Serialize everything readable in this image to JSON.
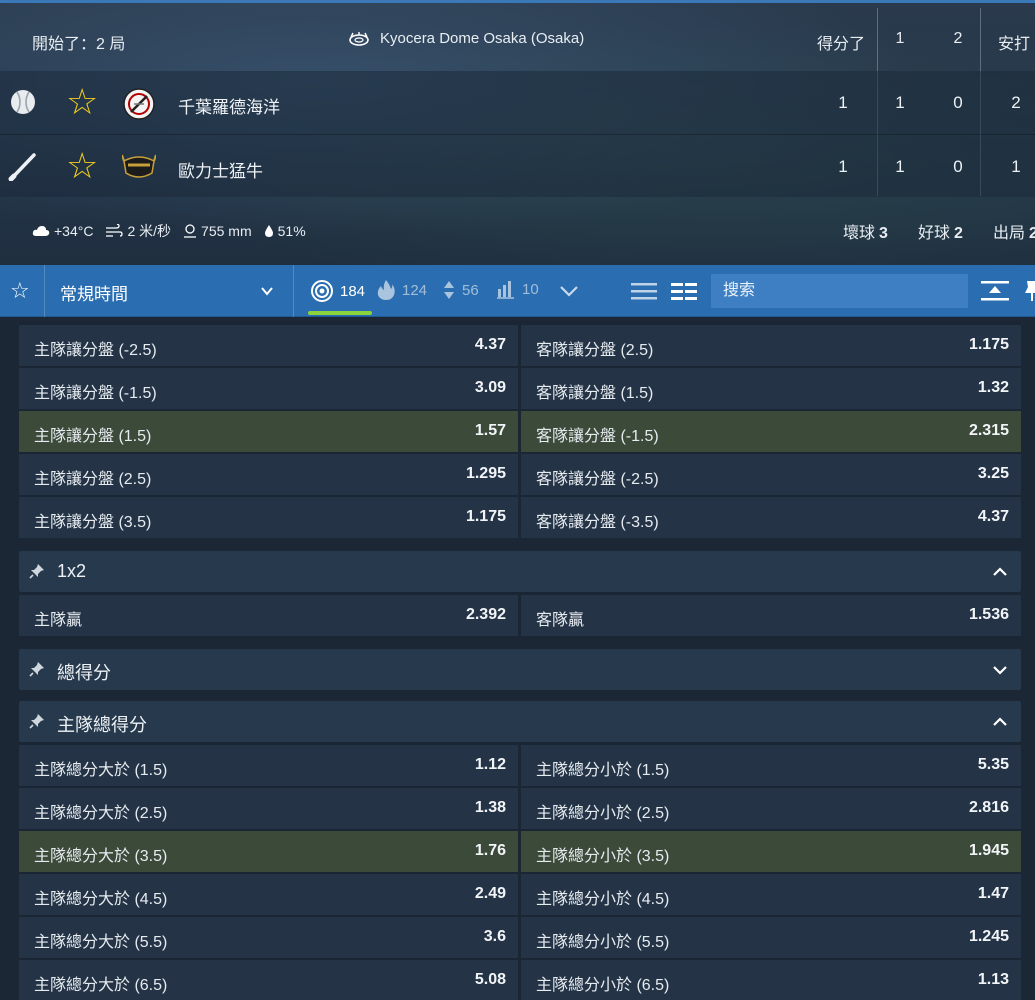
{
  "header": {
    "status": "開始了：2 局",
    "venue": "Kyocera Dome Osaka (Osaka)",
    "col_runs": "得分了",
    "col_inning1": "1",
    "col_inning2": "2",
    "col_hits": "安打",
    "teams": [
      {
        "name": "千葉羅德海洋",
        "runs": "1",
        "i1": "1",
        "i2": "0",
        "hits": "2",
        "status_icon": "baseball-icon"
      },
      {
        "name": "歐力士猛牛",
        "runs": "1",
        "i1": "1",
        "i2": "0",
        "hits": "1",
        "status_icon": "bat-icon"
      }
    ],
    "weather": {
      "temp": "+34°C",
      "wind": "2 米/秒",
      "pressure": "755 mm",
      "humidity": "51%"
    },
    "count": {
      "balls_label": "壞球",
      "balls": "3",
      "strikes_label": "好球",
      "strikes": "2",
      "outs_label": "出局",
      "outs": "2"
    }
  },
  "toolbar": {
    "period": "常規時間",
    "filters": [
      {
        "icon": "target-icon",
        "count": "184"
      },
      {
        "icon": "fire-icon",
        "count": "124"
      },
      {
        "icon": "sort-icon",
        "count": "56"
      },
      {
        "icon": "stats-icon",
        "count": "10"
      }
    ],
    "search_placeholder": "搜索"
  },
  "markets": {
    "handicap_rows": [
      {
        "l_label": "主隊讓分盤 (-2.5)",
        "l_val": "4.37",
        "r_label": "客隊讓分盤 (2.5)",
        "r_val": "1.175",
        "hl": false
      },
      {
        "l_label": "主隊讓分盤 (-1.5)",
        "l_val": "3.09",
        "r_label": "客隊讓分盤 (1.5)",
        "r_val": "1.32",
        "hl": false
      },
      {
        "l_label": "主隊讓分盤 (1.5)",
        "l_val": "1.57",
        "r_label": "客隊讓分盤 (-1.5)",
        "r_val": "2.315",
        "hl": true
      },
      {
        "l_label": "主隊讓分盤 (2.5)",
        "l_val": "1.295",
        "r_label": "客隊讓分盤 (-2.5)",
        "r_val": "3.25",
        "hl": false
      },
      {
        "l_label": "主隊讓分盤 (3.5)",
        "l_val": "1.175",
        "r_label": "客隊讓分盤 (-3.5)",
        "r_val": "4.37",
        "hl": false
      }
    ],
    "onex2": {
      "title": "1x2",
      "row": {
        "l_label": "主隊贏",
        "l_val": "2.392",
        "r_label": "客隊贏",
        "r_val": "1.536"
      }
    },
    "total": {
      "title": "總得分"
    },
    "home_total": {
      "title": "主隊總得分",
      "rows": [
        {
          "l_label": "主隊總分大於 (1.5)",
          "l_val": "1.12",
          "r_label": "主隊總分小於 (1.5)",
          "r_val": "5.35",
          "hl": false
        },
        {
          "l_label": "主隊總分大於 (2.5)",
          "l_val": "1.38",
          "r_label": "主隊總分小於 (2.5)",
          "r_val": "2.816",
          "hl": false
        },
        {
          "l_label": "主隊總分大於 (3.5)",
          "l_val": "1.76",
          "r_label": "主隊總分小於 (3.5)",
          "r_val": "1.945",
          "hl": true
        },
        {
          "l_label": "主隊總分大於 (4.5)",
          "l_val": "2.49",
          "r_label": "主隊總分小於 (4.5)",
          "r_val": "1.47",
          "hl": false
        },
        {
          "l_label": "主隊總分大於 (5.5)",
          "l_val": "3.6",
          "r_label": "主隊總分小於 (5.5)",
          "r_val": "1.245",
          "hl": false
        },
        {
          "l_label": "主隊總分大於 (6.5)",
          "l_val": "5.08",
          "r_label": "主隊總分小於 (6.5)",
          "r_val": "1.13",
          "hl": false
        }
      ]
    }
  }
}
